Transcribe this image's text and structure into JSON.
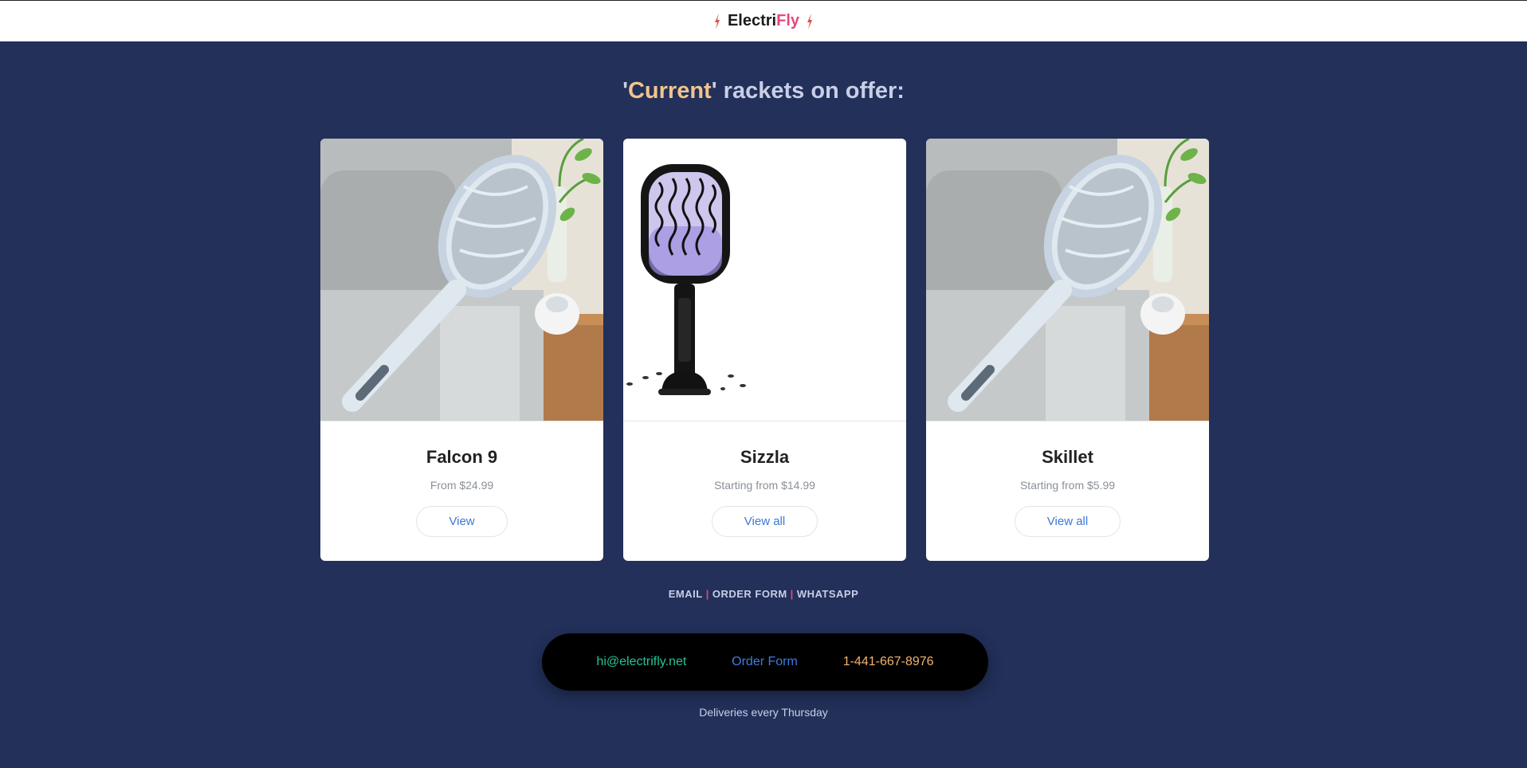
{
  "brand": {
    "name_part1": "Electri",
    "name_part2": "Fly"
  },
  "headline": {
    "open_quote": "'",
    "highlight": "Current",
    "rest": "' rackets on offer:"
  },
  "products": [
    {
      "title": "Falcon 9",
      "price": "From $24.99",
      "button": "View"
    },
    {
      "title": "Sizzla",
      "price": "Starting from $14.99",
      "button": "View all"
    },
    {
      "title": "Skillet",
      "price": "Starting from $5.99",
      "button": "View all"
    }
  ],
  "footer_links": {
    "email": "EMAIL",
    "order_form": "ORDER FORM",
    "whatsapp": "WHATSAPP",
    "separator": "|"
  },
  "contact": {
    "email": "hi@electrifly.net",
    "order": "Order Form",
    "phone": "1-441-667-8976"
  },
  "deliveries": "Deliveries every Thursday",
  "colors": {
    "background": "#22305a",
    "accent_pink": "#e8467c",
    "accent_gold": "#f2c48c",
    "link_blue": "#3f7be0",
    "email_green": "#25c49a",
    "phone_orange": "#f2b36e"
  },
  "icons": {
    "brand_left": "bolt-icon",
    "brand_right": "bolt-icon"
  }
}
